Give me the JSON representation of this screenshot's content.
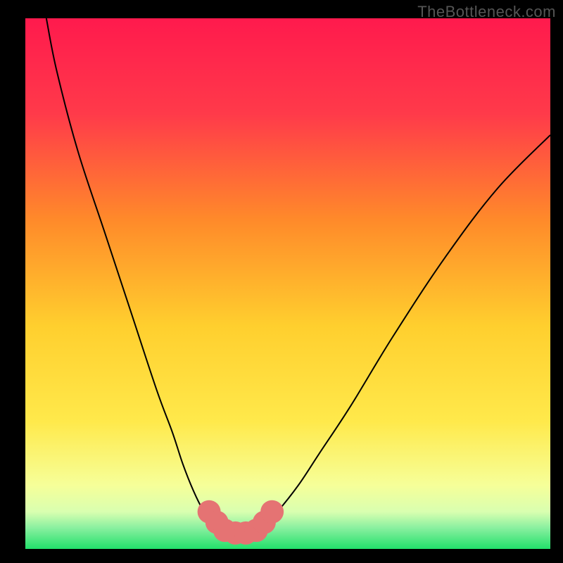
{
  "watermark": "TheBottleneck.com",
  "chart_data": {
    "type": "line",
    "title": "",
    "xlabel": "",
    "ylabel": "",
    "xlim": [
      0,
      100
    ],
    "ylim": [
      0,
      100
    ],
    "grid": false,
    "background_gradient": {
      "top": "#ff1a4d",
      "mid_upper": "#ff8a2a",
      "mid": "#ffe033",
      "mid_lower": "#f6ff66",
      "green_band": "#22e06b",
      "bottom": "#22e06b"
    },
    "series": [
      {
        "name": "left-branch",
        "x": [
          4,
          6,
          10,
          15,
          20,
          25,
          28,
          30,
          32,
          34,
          36
        ],
        "y": [
          100,
          90,
          75,
          60,
          45,
          30,
          22,
          16,
          11,
          7,
          4
        ]
      },
      {
        "name": "right-branch",
        "x": [
          45,
          48,
          52,
          56,
          62,
          70,
          80,
          90,
          100
        ],
        "y": [
          4,
          7,
          12,
          18,
          27,
          40,
          55,
          68,
          78
        ]
      },
      {
        "name": "valley-floor",
        "x": [
          36,
          38,
          40,
          42,
          44,
          45
        ],
        "y": [
          4,
          2.5,
          2,
          2,
          2.5,
          4
        ]
      }
    ],
    "highlight": {
      "name": "bottleneck-marker",
      "color": "#e57373",
      "points_x": [
        35,
        36.5,
        38,
        40,
        42,
        44,
        45.5,
        47
      ],
      "points_y": [
        7,
        5,
        3.5,
        3,
        3,
        3.5,
        5,
        7
      ],
      "radius": 2.2
    }
  }
}
